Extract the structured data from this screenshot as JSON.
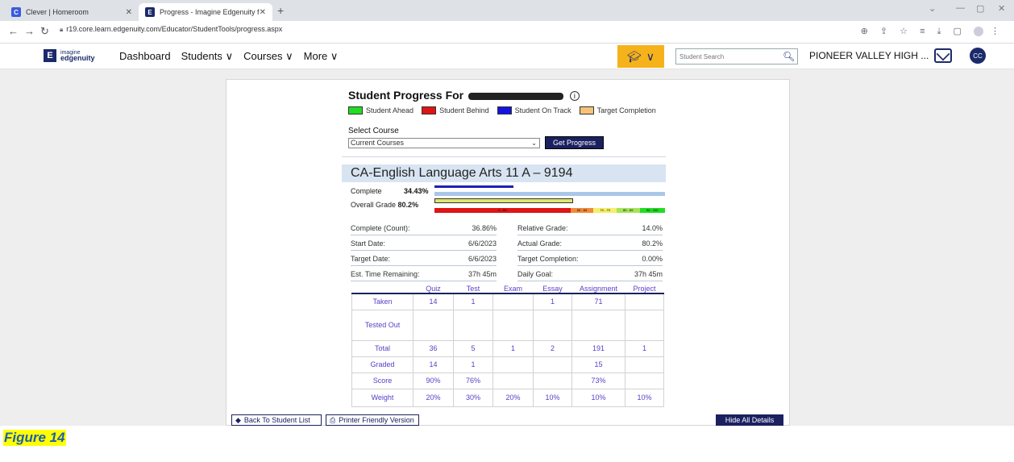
{
  "browser": {
    "tabs": [
      {
        "title": "Clever | Homeroom",
        "favicon": "C",
        "favicon_color": "#3b5bdb",
        "active": false
      },
      {
        "title": "Progress - Imagine Edgenuity fo",
        "favicon": "E",
        "favicon_color": "#1b2a6b",
        "active": true
      }
    ],
    "url": "r19.core.learn.edgenuity.com/Educator/StudentTools/progress.aspx"
  },
  "header": {
    "logo_small": "imagine",
    "logo_name": "edgenuity",
    "nav": [
      "Dashboard",
      "Students",
      "Courses",
      "More"
    ],
    "search_placeholder": "Student Search",
    "school": "PIONEER VALLEY HIGH ...",
    "avatar": "CC",
    "role_color": "#f5b21b"
  },
  "page": {
    "title": "Student Progress For",
    "legend": [
      {
        "label": "Student Ahead",
        "color": "#22dd22"
      },
      {
        "label": "Student Behind",
        "color": "#e01414"
      },
      {
        "label": "Student On Track",
        "color": "#1414e0"
      },
      {
        "label": "Target Completion",
        "color": "#f6c27a"
      }
    ],
    "select_label": "Select Course",
    "select_value": "Current Courses",
    "get_button": "Get Progress",
    "course_title": "CA-English Language Arts 11 A – 9194",
    "complete_label": "Complete",
    "complete_value": "34.43%",
    "complete_fraction": 0.3443,
    "grade_label": "Overall Grade",
    "grade_value": "80.2%",
    "grade_fraction": 0.602,
    "grade_scale": [
      {
        "label": "0 - 59",
        "color": "#e01414"
      },
      {
        "label": "60 - 69",
        "color": "#f08a3a"
      },
      {
        "label": "70 - 79",
        "color": "#f5ef6a"
      },
      {
        "label": "80 - 89",
        "color": "#a6e35a"
      },
      {
        "label": "90 - 100",
        "color": "#22dd22"
      }
    ],
    "stats": [
      {
        "l1": "Complete (Count):",
        "v1": "36.86%",
        "l2": "Relative Grade:",
        "v2": "14.0%"
      },
      {
        "l1": "Start Date:",
        "v1": "6/6/2023",
        "l2": "Actual Grade:",
        "v2": "80.2%"
      },
      {
        "l1": "Target Date:",
        "v1": "6/6/2023",
        "l2": "Target Completion:",
        "v2": "0.00%"
      },
      {
        "l1": "Est. Time Remaining:",
        "v1": "37h 45m",
        "l2": "Daily Goal:",
        "v2": "37h 45m"
      }
    ],
    "table": {
      "columns": [
        "",
        "Quiz",
        "Test",
        "Exam",
        "Essay",
        "Assignment",
        "Project"
      ],
      "rows": [
        {
          "label": "Taken",
          "cells": [
            "14",
            "1",
            "",
            "1",
            "71",
            ""
          ]
        },
        {
          "label": "Tested Out",
          "cells": [
            "",
            "",
            "",
            "",
            "",
            ""
          ]
        },
        {
          "label": "Total",
          "cells": [
            "36",
            "5",
            "1",
            "2",
            "191",
            "1"
          ]
        },
        {
          "label": "Graded",
          "cells": [
            "14",
            "1",
            "",
            "",
            "15",
            ""
          ]
        },
        {
          "label": "Score",
          "cells": [
            "90%",
            "76%",
            "",
            "",
            "73%",
            ""
          ]
        },
        {
          "label": "Weight",
          "cells": [
            "20%",
            "30%",
            "20%",
            "10%",
            "10%",
            "10%"
          ]
        }
      ]
    },
    "back_button": "Back To Student List",
    "printer_button": "Printer Friendly Version",
    "hide_button": "Hide All Details"
  },
  "caption": "Figure 14"
}
